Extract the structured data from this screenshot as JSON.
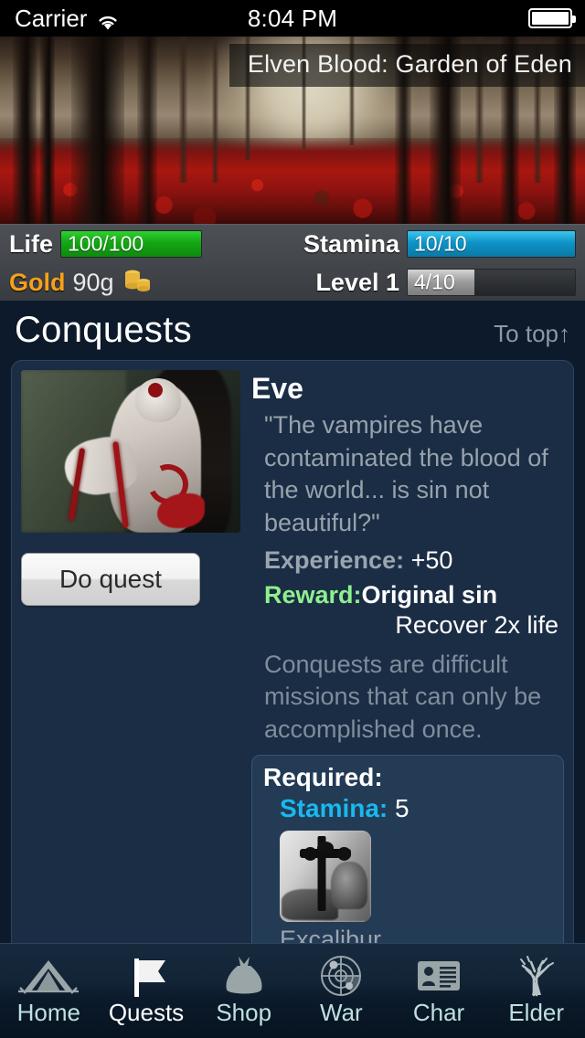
{
  "status_bar": {
    "carrier": "Carrier",
    "wifi_icon": "wifi-icon",
    "time": "8:04 PM",
    "battery_icon": "battery-full-icon"
  },
  "banner": {
    "title": "Elven Blood: Garden of Eden",
    "scene": "red-forest-banner"
  },
  "stats": {
    "life_label": "Life",
    "life_value": "100/100",
    "life_percent": 100,
    "life_color": "#14a614",
    "stamina_label": "Stamina",
    "stamina_value": "10/10",
    "stamina_percent": 100,
    "stamina_color": "#0d93c7",
    "gold_label": "Gold",
    "gold_value": "90g",
    "gold_icon": "coin-stack-icon",
    "gold_color": "#f6a01c",
    "level_label": "Level 1",
    "level_value": "4/10",
    "level_percent": 40,
    "level_color": "#9a9a9a"
  },
  "section": {
    "title": "Conquests",
    "to_top": "To top↑"
  },
  "quest": {
    "name": "Eve",
    "portrait": "eve-portrait",
    "quote": "\"The vampires have contaminated the blood of the world... is sin not beautiful?\"",
    "do_quest_label": "Do quest",
    "experience_label": "Experience:",
    "experience_value": "+50",
    "reward_label": "Reward:",
    "reward_value": "Original sin",
    "reward_effect": "Recover 2x life",
    "description": "Conquests are difficult missions that can only be accomplished once.",
    "required": {
      "title": "Required:",
      "stamina_label": "Stamina:",
      "stamina_value": "5",
      "item_name": "Excalibur",
      "item_icon": "excalibur-thumbnail"
    }
  },
  "tabbar": {
    "items": [
      {
        "label": "Home",
        "icon": "tent-icon",
        "active": false
      },
      {
        "label": "Quests",
        "icon": "flag-icon",
        "active": true
      },
      {
        "label": "Shop",
        "icon": "moneybag-icon",
        "active": false
      },
      {
        "label": "War",
        "icon": "radar-icon",
        "active": false
      },
      {
        "label": "Char",
        "icon": "idcard-icon",
        "active": false
      },
      {
        "label": "Elder",
        "icon": "tree-icon",
        "active": false
      }
    ]
  }
}
